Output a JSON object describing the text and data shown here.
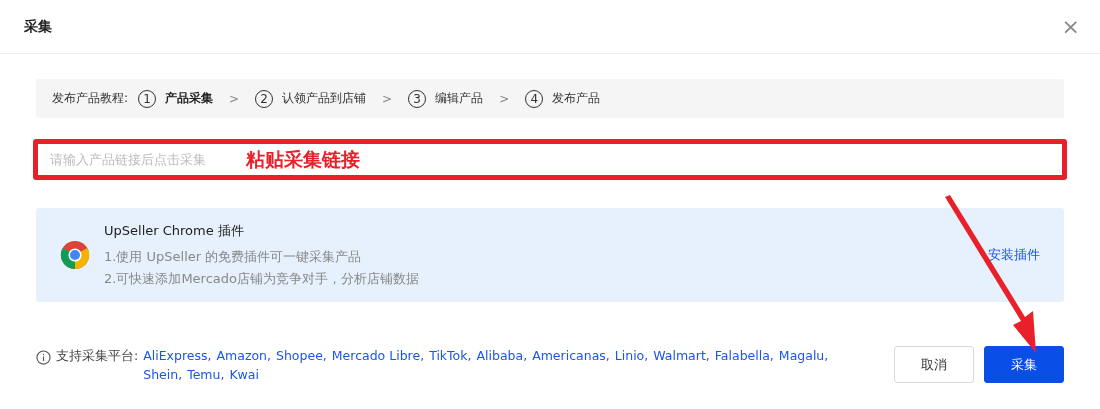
{
  "dialog": {
    "title": "采集",
    "close": "×"
  },
  "tutorial": {
    "label": "发布产品教程:",
    "steps": [
      {
        "number": "1",
        "label": "产品采集",
        "selected": true
      },
      {
        "number": "2",
        "label": "认领产品到店铺",
        "selected": false
      },
      {
        "number": "3",
        "label": "编辑产品",
        "selected": false
      },
      {
        "number": "4",
        "label": "发布产品",
        "selected": false
      }
    ],
    "separator": ">"
  },
  "link_input": {
    "placeholder": "请输入产品链接后点击采集"
  },
  "annotation": {
    "text": "粘贴采集链接"
  },
  "plugin": {
    "title": "UpSeller Chrome 插件",
    "lines": [
      "1.使用 UpSeller 的免费插件可一键采集产品",
      "2.可快速添加Mercado店铺为竞争对手，分析店铺数据"
    ],
    "install": "安装插件"
  },
  "platforms": {
    "label": "支持采集平台:",
    "items": [
      "AliExpress,",
      "Amazon,",
      "Shopee,",
      "Mercado Libre,",
      "TikTok,",
      "Alibaba,",
      "Americanas,",
      "Linio,",
      "Walmart,",
      "Falabella,",
      "Magalu,",
      "Shein,",
      "Temu,",
      "Kwai"
    ]
  },
  "buttons": [
    {
      "label": "取消",
      "kind": "secondary"
    },
    {
      "label": "采集",
      "kind": "primary"
    }
  ]
}
